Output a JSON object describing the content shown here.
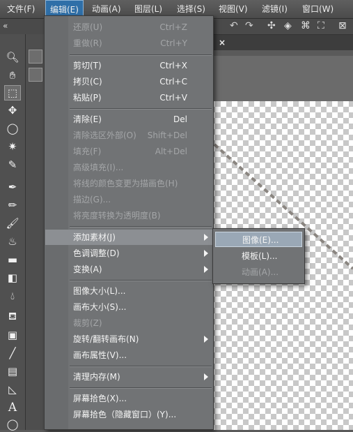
{
  "menubar": {
    "items": [
      "文件(F)",
      "编辑(E)",
      "动画(A)",
      "图层(L)",
      "选择(S)",
      "视图(V)",
      "滤镜(I)",
      "窗口(W)"
    ]
  },
  "edit_menu": {
    "items": [
      {
        "label": "还原(U)",
        "shortcut": "Ctrl+Z",
        "disabled": true
      },
      {
        "label": "重做(R)",
        "shortcut": "Ctrl+Y",
        "disabled": true
      },
      {
        "label": "剪切(T)",
        "shortcut": "Ctrl+X",
        "disabled": false
      },
      {
        "label": "拷贝(C)",
        "shortcut": "Ctrl+C",
        "disabled": false
      },
      {
        "label": "粘贴(P)",
        "shortcut": "Ctrl+V",
        "disabled": false
      },
      {
        "label": "清除(E)",
        "shortcut": "Del",
        "disabled": false
      },
      {
        "label": "清除选区外部(O)",
        "shortcut": "Shift+Del",
        "disabled": true
      },
      {
        "label": "填充(F)",
        "shortcut": "Alt+Del",
        "disabled": true
      },
      {
        "label": "高级填充(I)...",
        "shortcut": "",
        "disabled": true
      },
      {
        "label": "将线的颜色变更为描画色(H)",
        "shortcut": "",
        "disabled": true
      },
      {
        "label": "描边(G)...",
        "shortcut": "",
        "disabled": true
      },
      {
        "label": "将亮度转换为透明度(B)",
        "shortcut": "",
        "disabled": true
      },
      {
        "label": "添加素材(J)",
        "shortcut": "",
        "disabled": false,
        "submenu": true
      },
      {
        "label": "色调调整(D)",
        "shortcut": "",
        "disabled": false,
        "submenu": true
      },
      {
        "label": "变换(A)",
        "shortcut": "",
        "disabled": false,
        "submenu": true
      },
      {
        "label": "图像大小(L)...",
        "shortcut": "",
        "disabled": false
      },
      {
        "label": "画布大小(S)...",
        "shortcut": "",
        "disabled": false
      },
      {
        "label": "裁剪(Z)",
        "shortcut": "",
        "disabled": true
      },
      {
        "label": "旋转/翻转画布(N)",
        "shortcut": "",
        "disabled": false,
        "submenu": true
      },
      {
        "label": "画布属性(V)...",
        "shortcut": "",
        "disabled": false
      },
      {
        "label": "清理内存(M)",
        "shortcut": "",
        "disabled": false,
        "submenu": true
      },
      {
        "label": "屏幕拾色(X)...",
        "shortcut": "",
        "disabled": false
      },
      {
        "label": "屏幕拾色（隐藏窗口）(Y)...",
        "shortcut": "",
        "disabled": false
      }
    ]
  },
  "add_material_submenu": {
    "items": [
      {
        "label": "图像(E)...",
        "disabled": false
      },
      {
        "label": "模板(L)...",
        "disabled": false
      },
      {
        "label": "动画(A)...",
        "disabled": true
      }
    ]
  },
  "colors": {
    "active_menu": "#2f6fa8",
    "menu_bg": "#717375",
    "highlight": "#8c8f93"
  }
}
